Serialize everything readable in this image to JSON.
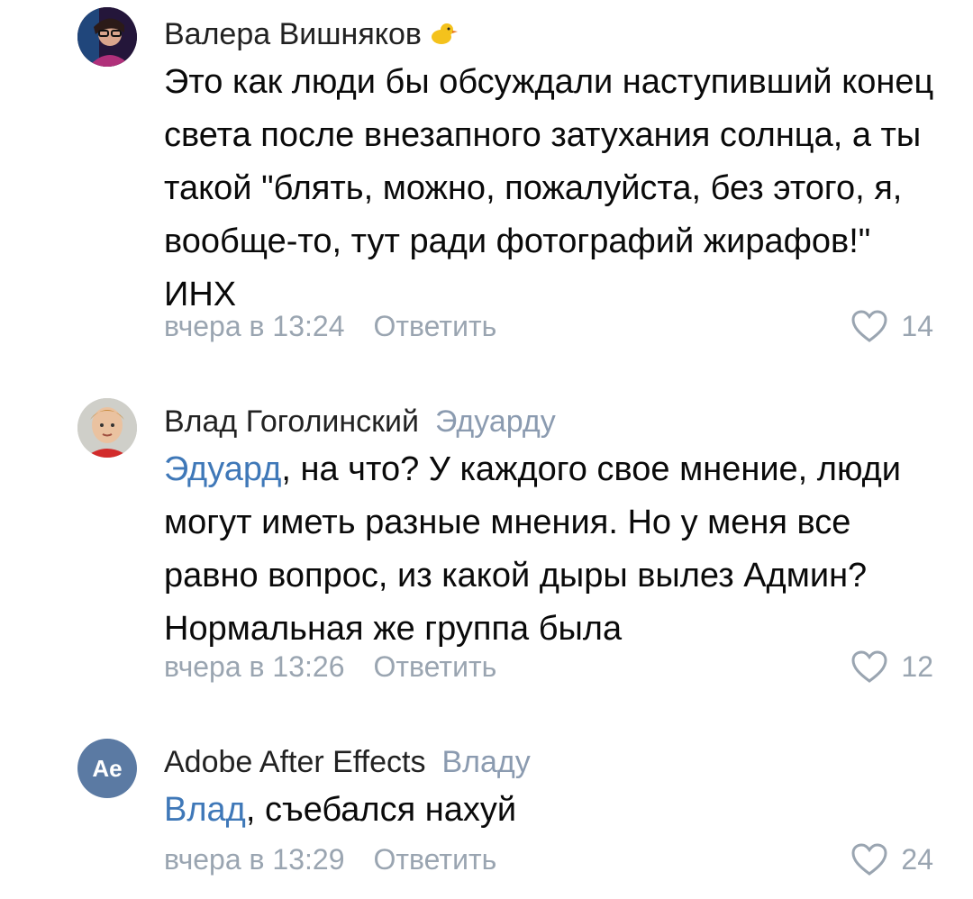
{
  "comments": [
    {
      "author": "Валера Вишняков",
      "reply_to": "",
      "text": "Это как люди бы обсуждали наступивший конец света после внезапного затухания солнца, а ты такой \"блять, можно, пожалуйста, без этого, я, вообще-то, тут ради фотографий жирафов!\" ИНХ",
      "time": "вчера в 13:24",
      "reply_label": "Ответить",
      "likes": "14",
      "author_emoji": "duck-emoji"
    },
    {
      "author": "Влад Гоголинский",
      "reply_to": "Эдуарду",
      "mention": "Эдуард",
      "text": ", на что? У каждого свое мнение, люди могут иметь разные мнения. Но у меня все равно вопрос, из какой дыры вылез Админ? Нормальная же группа была",
      "time": "вчера в 13:26",
      "reply_label": "Ответить",
      "likes": "12"
    },
    {
      "author": "Adobe After Effects",
      "reply_to": "Владу",
      "mention": "Влад",
      "text": ", съебался нахуй",
      "time": "вчера в 13:29",
      "reply_label": "Ответить",
      "likes": "24",
      "avatar_text": "Ae"
    }
  ],
  "colors": {
    "mention": "#3f78b8",
    "meta": "#9aa5b1",
    "ae_avatar": "#5b7aa3"
  }
}
